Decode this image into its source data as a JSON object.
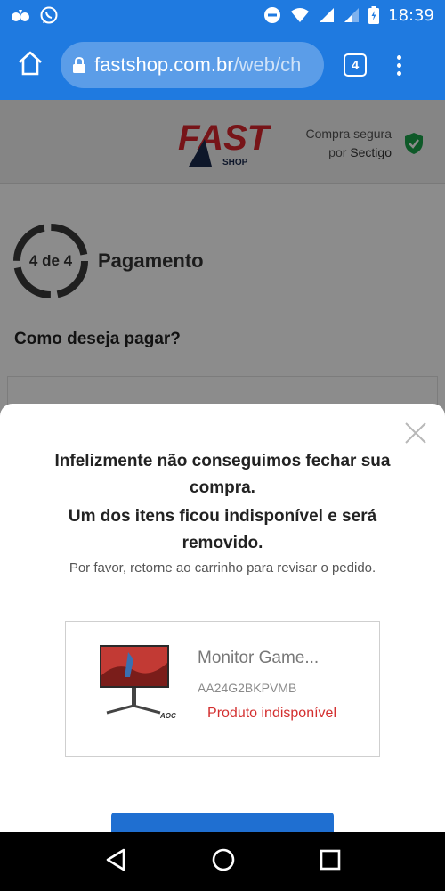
{
  "status_bar": {
    "time": "18:39",
    "icons": [
      "notification-app-icon",
      "whatsapp-icon",
      "do-not-disturb-icon",
      "wifi-icon",
      "signal-icon",
      "signal-weak-icon",
      "battery-charging-icon"
    ]
  },
  "browser": {
    "url_domain": "fastshop.com.br",
    "url_path": "/web/ch",
    "tab_count": "4",
    "icons": [
      "home-icon",
      "lock-icon",
      "more-vert-icon"
    ]
  },
  "site_header": {
    "logo_text": "FAST",
    "logo_subtext": "SHOP",
    "secure_line1": "Compra segura",
    "secure_line2_prefix": "por",
    "secure_line2_brand": "Sectigo",
    "colors": {
      "logo_red": "#d9262c",
      "logo_navy": "#1b2a4e",
      "shield_green": "#1aa34a"
    }
  },
  "checkout": {
    "step_label": "4 de 4",
    "step_title": "Pagamento",
    "payment_question": "Como deseja pagar?",
    "steps_completed": 4,
    "steps_total": 4
  },
  "modal": {
    "title_line1": "Infelizmente não conseguimos fechar sua compra.",
    "title_line2": "Um dos itens ficou indisponível e será removido.",
    "note": "Por favor, retorne ao carrinho para revisar o pedido.",
    "product": {
      "name": "Monitor Game...",
      "sku": "AA24G2BKPVMB",
      "status": "Produto indisponível",
      "brand_mark": "AOC"
    },
    "colors": {
      "status_red": "#d32f2f",
      "cta_blue": "#1f6fd1"
    }
  },
  "nav_bar": {
    "icons": [
      "back-icon",
      "home-circle-icon",
      "recents-icon"
    ]
  },
  "colors": {
    "chrome_blue": "#1f7ae0"
  }
}
